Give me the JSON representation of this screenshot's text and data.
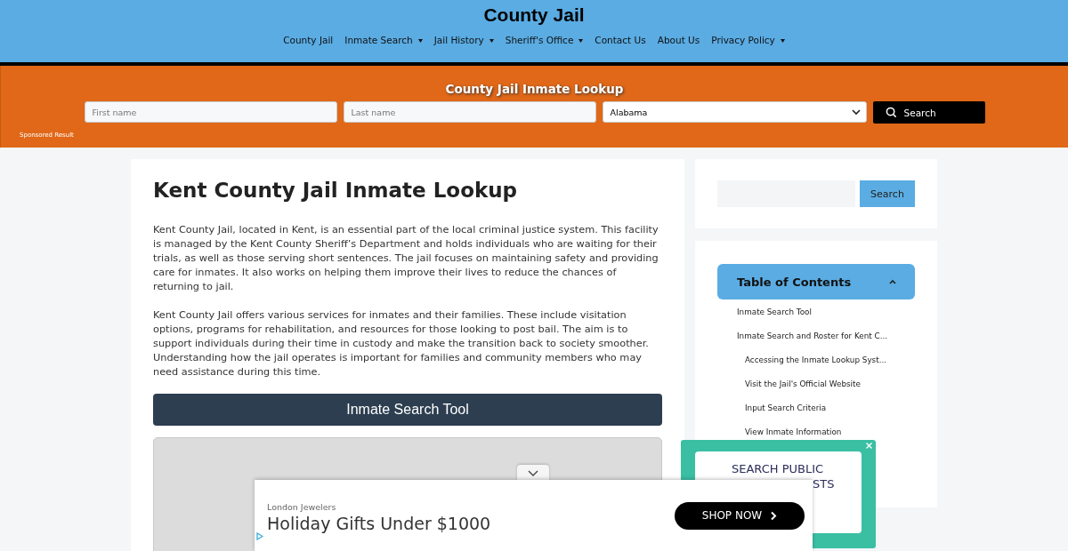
{
  "site": {
    "title": "County Jail"
  },
  "nav": [
    {
      "label": "County Jail",
      "dropdown": false
    },
    {
      "label": "Inmate Search",
      "dropdown": true
    },
    {
      "label": "Jail History",
      "dropdown": true
    },
    {
      "label": "Sheriff's Office",
      "dropdown": true
    },
    {
      "label": "Contact Us",
      "dropdown": false
    },
    {
      "label": "About Us",
      "dropdown": false
    },
    {
      "label": "Privacy Policy",
      "dropdown": true
    }
  ],
  "lookup": {
    "title": "County Jail Inmate Lookup",
    "first_name": {
      "placeholder": "First name"
    },
    "last_name": {
      "placeholder": "Last name"
    },
    "state": "Alabama",
    "button": "Search",
    "note": "Sponsored Result"
  },
  "article": {
    "title": "Kent County Jail Inmate Lookup",
    "paragraphs": [
      "Kent County Jail, located in Kent, is an essential part of the local criminal justice system. This facility is managed by the Kent County Sheriff’s Department and holds individuals who are waiting for their trials, as well as those serving short sentences. The jail focuses on maintaining safety and providing care for inmates. It also works on helping them improve their lives to reduce the chances of returning to jail.",
      "Kent County Jail offers various services for inmates and their families. These include visitation options, programs for rehabilitation, and resources for those looking to post bail. The aim is to support individuals during their time in custody and make the transition back to society smoother. Understanding how the jail operates is important for families and community members who may need assistance during this time."
    ],
    "tool_heading": "Inmate Search Tool"
  },
  "sidebar": {
    "search_button": "Search",
    "toc": {
      "title": "Table of Contents",
      "expanded": true,
      "items": [
        {
          "label": "Inmate Search Tool"
        },
        {
          "label": "Inmate Search and Roster for Kent C...",
          "children": [
            {
              "label": "Accessing the Inmate Lookup Syst..."
            },
            {
              "label": "Visit the Jail's Official Website"
            },
            {
              "label": "Input Search Criteria"
            },
            {
              "label": "View Inmate Information"
            }
          ]
        }
      ]
    }
  },
  "popup": {
    "lines": [
      "SEARCH PUBLIC",
      "STS"
    ]
  },
  "ad": {
    "advertiser": "London Jewelers",
    "headline": "Holiday Gifts Under $1000",
    "button": "SHOP NOW"
  }
}
